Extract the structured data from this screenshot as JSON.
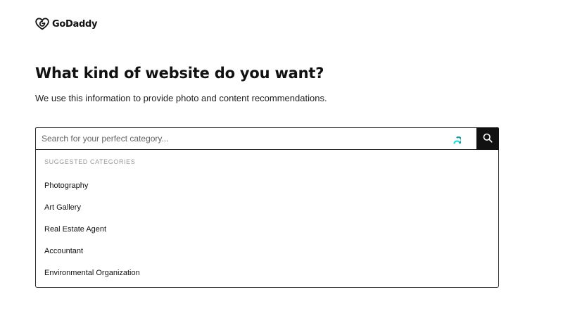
{
  "brand": {
    "name": "GoDaddy",
    "logo_icon": "godaddy-heart-logo-icon"
  },
  "heading": {
    "title": "What kind of website do you want?",
    "subtitle": "We use this information to provide photo and content recommendations."
  },
  "search": {
    "placeholder": "Search for your perfect category...",
    "value": "",
    "loading_icon": "spinner-icon",
    "button_icon": "search-icon",
    "spinner_color": "#1bdbdb"
  },
  "dropdown": {
    "heading": "SUGGESTED CATEGORIES",
    "items": [
      {
        "label": "Photography"
      },
      {
        "label": "Art Gallery"
      },
      {
        "label": "Real Estate Agent"
      },
      {
        "label": "Accountant"
      },
      {
        "label": "Environmental Organization"
      }
    ]
  },
  "colors": {
    "text": "#111111",
    "border": "#2b2b2b",
    "button_bg": "#111111",
    "muted": "#9a9a9a"
  }
}
